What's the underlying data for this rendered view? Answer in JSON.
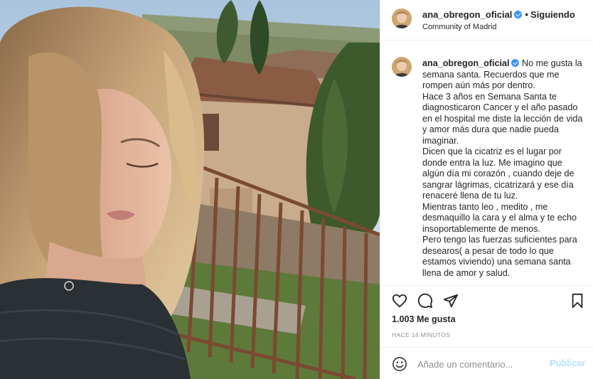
{
  "post": {
    "username": "ana_obregon_oficial",
    "separator": "•",
    "follow_status": "Siguiendo",
    "location": "Community of Madrid",
    "caption_user": "ana_obregon_oficial",
    "caption_lines": [
      "No me gusta la semana santa. Recuerdos que me rompen aún más por dentro.",
      "Hace 3 años en Semana Santa te diagnosticaron Cancer y el año pasado en el hospital me diste la lección de vida y amor más dura que nadie pueda imaginar.",
      "Dicen que la cicatriz es el lugar por donde entra la luz. Me imagino que algún día mi corazón , cuando deje de sangrar lágrimas, cicatrizará y ese día renaceré llena de tu luz.",
      "Mientras tanto leo , medito , me desmaquillo la cara y el alma y te echo insoportablemente de menos.",
      "Pero tengo las fuerzas suficientes para desearos( a pesar de todo lo que estamos viviendo) una semana santa llena de amor y salud."
    ],
    "likes": "1.003 Me gusta",
    "time_ago": "HACE 14 MINUTOS"
  },
  "comment": {
    "placeholder": "Añade un comentario...",
    "publish_label": "Publicar"
  },
  "icons": {
    "verified": "verified-badge-icon",
    "like": "heart-icon",
    "comment": "comment-bubble-icon",
    "share": "paper-plane-icon",
    "save": "bookmark-icon",
    "emoji": "emoji-smile-icon",
    "more": "more-options-icon"
  },
  "colors": {
    "verified_blue": "#3897f0",
    "publish_disabled": "#b2dffc",
    "muted_text": "#8e8e8e",
    "border": "#efefef"
  }
}
